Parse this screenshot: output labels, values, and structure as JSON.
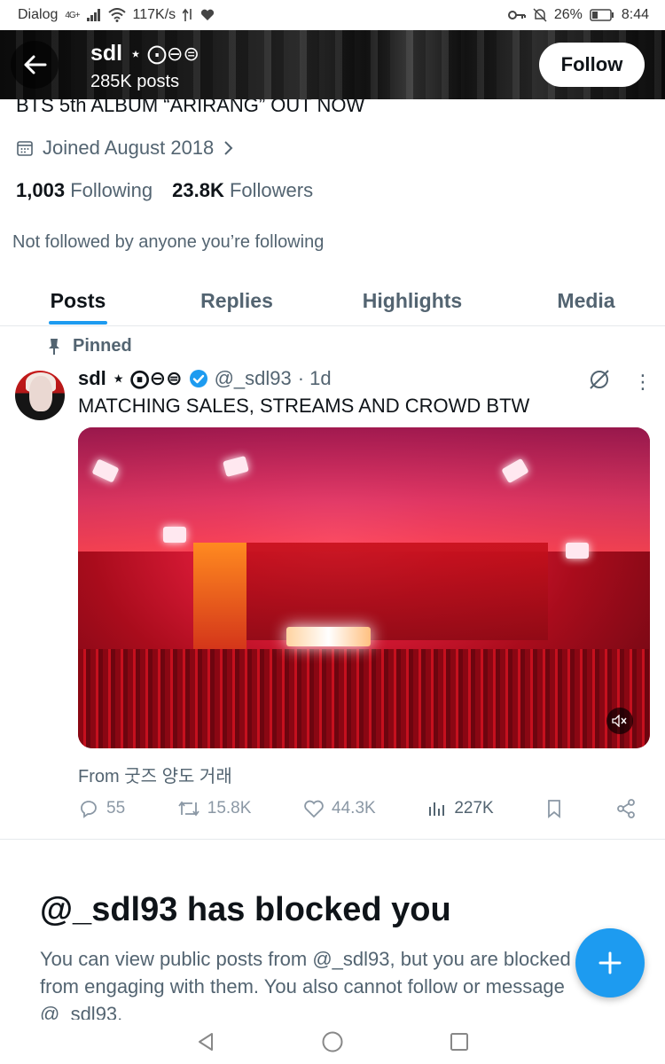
{
  "status_bar": {
    "carrier": "Dialog",
    "network": "4G+",
    "speed": "117K/s",
    "battery": "26%",
    "time": "8:44"
  },
  "header": {
    "name": "sdl",
    "name_symbols": "⋆ ⨀⊖⊜",
    "posts_count": "285K posts",
    "follow_label": "Follow"
  },
  "profile": {
    "bio": "BTS 5th ALBUM “ARIRANG” OUT NOW",
    "joined": "Joined August 2018",
    "following_count": "1,003",
    "following_label": "Following",
    "followers_count": "23.8K",
    "followers_label": "Followers",
    "not_followed": "Not followed by anyone you’re following"
  },
  "tabs": [
    {
      "label": "Posts",
      "active": true
    },
    {
      "label": "Replies",
      "active": false
    },
    {
      "label": "Highlights",
      "active": false
    },
    {
      "label": "Media",
      "active": false
    }
  ],
  "tweet": {
    "pinned_label": "Pinned",
    "author_name": "sdl",
    "author_symbols": "⋆ ⨀⊖⊜",
    "handle": "@_sdl93",
    "time": "· 1d",
    "text": "MATCHING SALES, STREAMS AND CROWD BTW",
    "from": "From 굿즈 양도 거래",
    "replies": "55",
    "reposts": "15.8K",
    "likes": "44.3K",
    "views": "227K"
  },
  "blocked": {
    "title": "@_sdl93 has blocked you",
    "text": "You can view public posts from @_sdl93, but you are blocked from engaging with them. You also cannot follow or message @_sdl93."
  },
  "colors": {
    "accent": "#1d9bf0",
    "text_primary": "#0f1419",
    "text_secondary": "#536471"
  }
}
